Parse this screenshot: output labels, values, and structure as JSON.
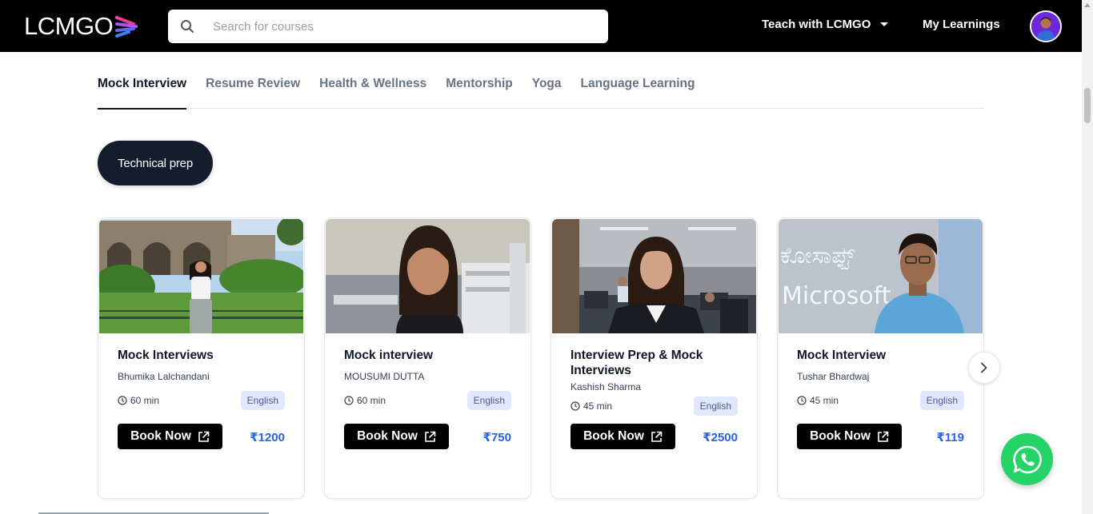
{
  "header": {
    "logo_text": "LCMGO",
    "search_placeholder": "Search for courses",
    "teach_label": "Teach with LCMGO",
    "my_learnings_label": "My Learnings"
  },
  "tabs": [
    {
      "label": "Mock Interview",
      "active": true
    },
    {
      "label": "Resume Review",
      "active": false
    },
    {
      "label": "Health & Wellness",
      "active": false
    },
    {
      "label": "Mentorship",
      "active": false
    },
    {
      "label": "Yoga",
      "active": false
    },
    {
      "label": "Language Learning",
      "active": false
    }
  ],
  "filter_chip": "Technical prep",
  "cards": [
    {
      "title": "Mock Interviews",
      "host": "Bhumika Lalchandani",
      "duration": "60 min",
      "language": "English",
      "book_label": "Book Now",
      "price": "₹1200"
    },
    {
      "title": "Mock interview",
      "host": "MOUSUMI DUTTA",
      "duration": "60 min",
      "language": "English",
      "book_label": "Book Now",
      "price": "₹750"
    },
    {
      "title": "Interview Prep & Mock Interviews",
      "host": "Kashish Sharma",
      "duration": "45 min",
      "language": "English",
      "book_label": "Book Now",
      "price": "₹2500"
    },
    {
      "title": "Mock Interview",
      "host": "Tushar Bhardwaj",
      "duration": "45 min",
      "language": "English",
      "book_label": "Book Now",
      "price": "₹119"
    }
  ],
  "card4_image_text": {
    "kannada": "ಕೋಸಾಫ್ಟ್",
    "brand": "Microsoft"
  },
  "icons": {
    "search": "search-icon",
    "dropdown": "chevron-down-icon",
    "clock": "clock-icon",
    "external": "external-link-icon",
    "next": "chevron-right-icon",
    "whatsapp": "whatsapp-icon"
  },
  "colors": {
    "header_bg": "#000000",
    "chip_bg": "#141c2e",
    "price": "#2563eb",
    "lang_badge_bg": "#e0e7ff",
    "whatsapp": "#25d366"
  }
}
